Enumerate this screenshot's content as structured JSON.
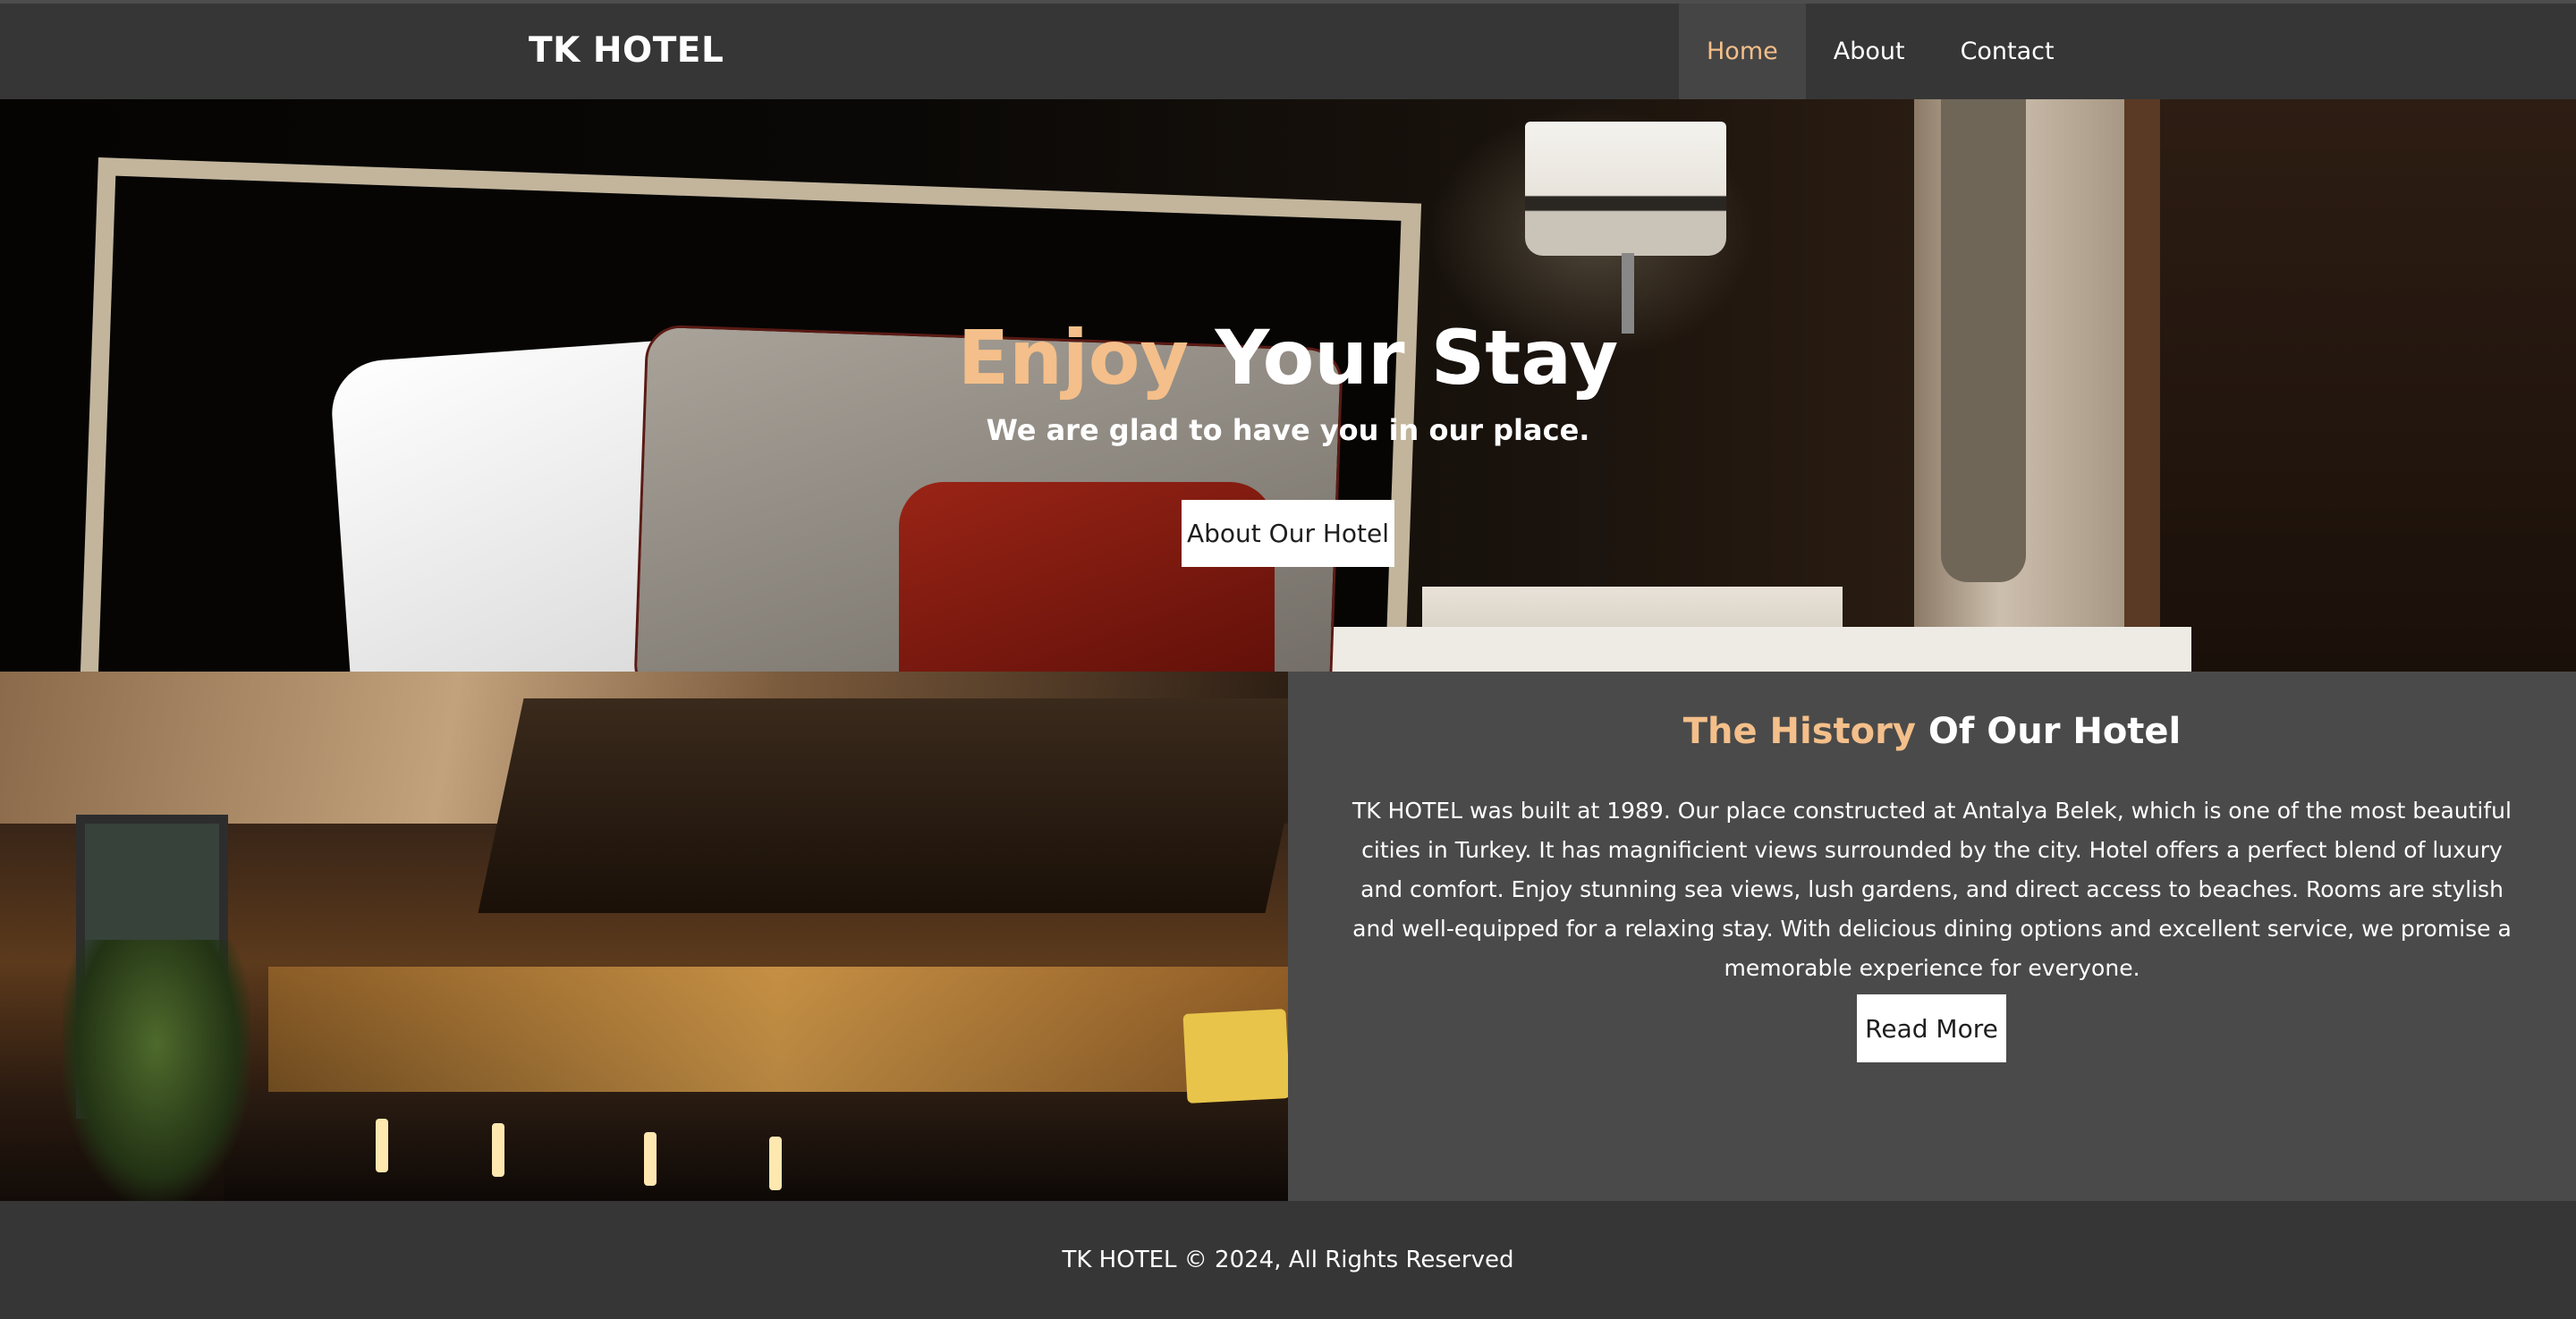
{
  "nav": {
    "brand": "TK HOTEL",
    "links": [
      {
        "label": "Home",
        "active": true
      },
      {
        "label": "About",
        "active": false
      },
      {
        "label": "Contact",
        "active": false
      }
    ]
  },
  "hero": {
    "title_accent": "Enjoy",
    "title_rest": " Your Stay",
    "subtitle": "We are glad to have you in our place.",
    "button_label": "About Our Hotel"
  },
  "history": {
    "title_accent": "The History",
    "title_rest": " Of Our Hotel",
    "body": "TK HOTEL was built at 1989. Our place constructed at Antalya Belek, which is one of the most beautiful cities in Turkey. It has magnificient views surrounded by the city. Hotel offers a perfect blend of luxury and comfort. Enjoy stunning sea views, lush gardens, and direct access to beaches. Rooms are stylish and well-equipped for a relaxing stay. With delicious dining options and excellent service, we promise a memorable experience for everyone.",
    "button_label": "Read More"
  },
  "footer": {
    "text": "TK HOTEL © 2024, All Rights Reserved"
  },
  "colors": {
    "accent": "#f4bf8a",
    "nav_bg": "#363636",
    "panel_bg": "#4a4a4a"
  }
}
